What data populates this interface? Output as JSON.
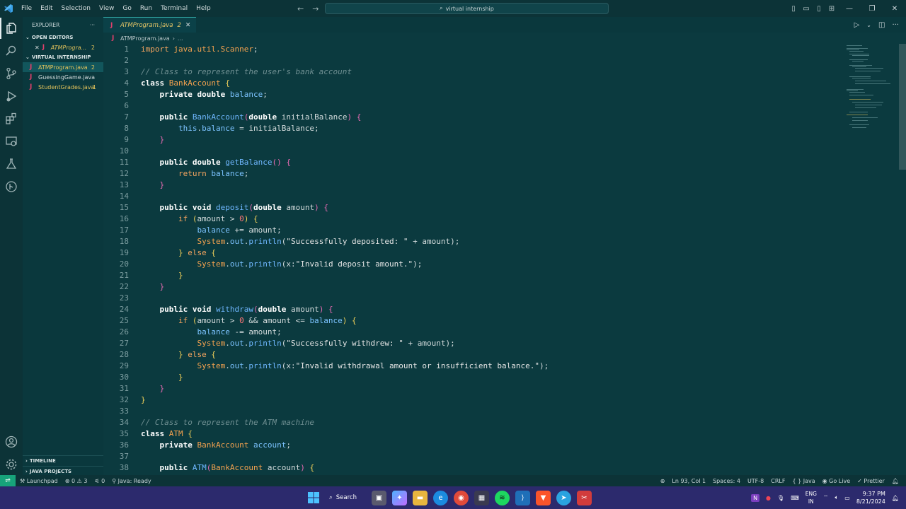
{
  "menu": [
    "File",
    "Edit",
    "Selection",
    "View",
    "Go",
    "Run",
    "Terminal",
    "Help"
  ],
  "search": {
    "text": "virtual internship"
  },
  "sidebar": {
    "title": "EXPLORER",
    "open_editors": "OPEN EDITORS",
    "open_files": [
      {
        "name": "ATMProgra...",
        "badge": "2"
      }
    ],
    "project": "VIRTUAL INTERNSHIP",
    "files": [
      {
        "name": "ATMProgram.java",
        "badge": "2"
      },
      {
        "name": "GuessingGame.java",
        "badge": ""
      },
      {
        "name": "StudentGrades.java",
        "badge": "1"
      }
    ],
    "timeline": "TIMELINE",
    "java_projects": "JAVA PROJECTS"
  },
  "tab": {
    "label": "ATMProgram.java",
    "badge": "2"
  },
  "breadcrumb": {
    "file": "ATMProgram.java",
    "rest": "..."
  },
  "code_lines": [
    {
      "n": "1"
    },
    {
      "n": "2"
    },
    {
      "n": "3"
    },
    {
      "n": "4"
    },
    {
      "n": "5"
    },
    {
      "n": "6"
    },
    {
      "n": "7"
    },
    {
      "n": "8"
    },
    {
      "n": "9"
    },
    {
      "n": "10"
    },
    {
      "n": "11"
    },
    {
      "n": "12"
    },
    {
      "n": "13"
    },
    {
      "n": "14"
    },
    {
      "n": "15"
    },
    {
      "n": "16"
    },
    {
      "n": "17"
    },
    {
      "n": "18"
    },
    {
      "n": "19"
    },
    {
      "n": "20"
    },
    {
      "n": "21"
    },
    {
      "n": "22"
    },
    {
      "n": "23"
    },
    {
      "n": "24"
    },
    {
      "n": "25"
    },
    {
      "n": "26"
    },
    {
      "n": "27"
    },
    {
      "n": "28"
    },
    {
      "n": "29"
    },
    {
      "n": "30"
    },
    {
      "n": "31"
    },
    {
      "n": "32"
    },
    {
      "n": "33"
    },
    {
      "n": "34"
    },
    {
      "n": "35"
    },
    {
      "n": "36"
    },
    {
      "n": "37"
    },
    {
      "n": "38"
    }
  ],
  "status": {
    "launchpad": "Launchpad",
    "errors": "0",
    "warnings": "3",
    "ports": "0",
    "java": "Java: Ready",
    "position": "Ln 93, Col 1",
    "spaces": "Spaces: 4",
    "encoding": "UTF-8",
    "eol": "CRLF",
    "language": "Java",
    "golive": "Go Live",
    "prettier": "Prettier"
  },
  "taskbar": {
    "search": "Search",
    "lang1": "ENG",
    "lang2": "IN",
    "time": "9:37 PM",
    "date": "8/21/2024"
  }
}
